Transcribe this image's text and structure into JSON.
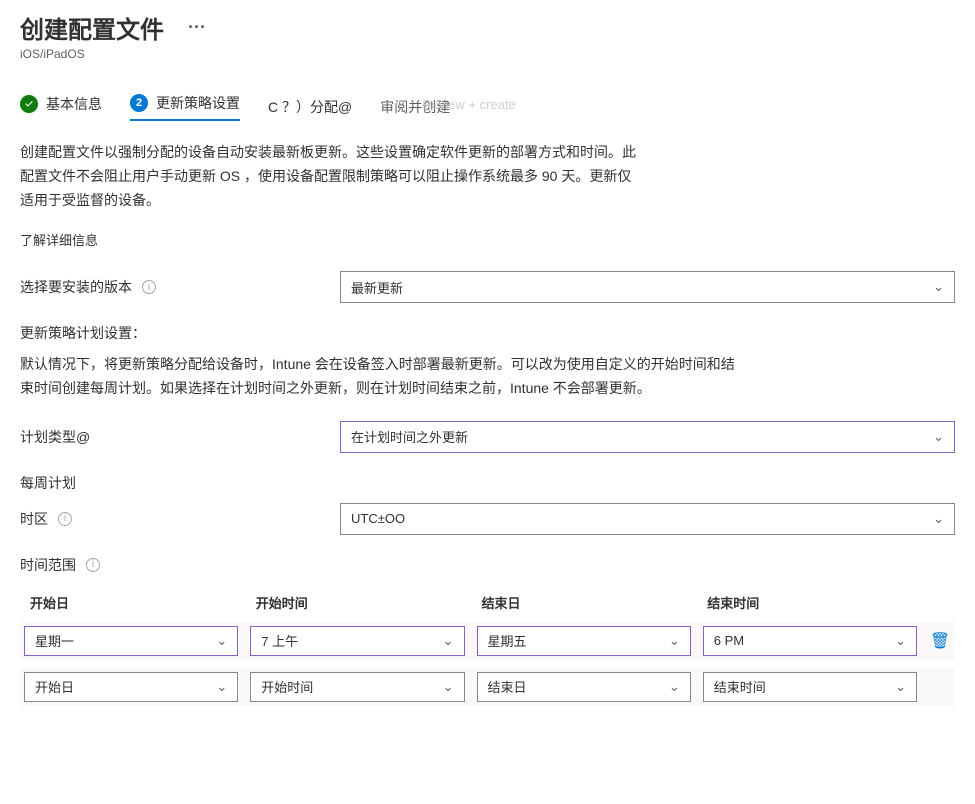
{
  "header": {
    "title": "创建配置文件",
    "subtitle": "iOS/iPadOS",
    "more_menu": "···"
  },
  "steps": {
    "s1": {
      "label": "基本信息"
    },
    "s2": {
      "label": "更新策略设置",
      "num": "2"
    },
    "s3": {
      "label": "C ？）分配@"
    },
    "s4": {
      "label": "审阅并创建",
      "ghost": "Review + create"
    }
  },
  "description": "创建配置文件以强制分配的设备自动安装最新板更新。这些设置确定软件更新的部署方式和时间。此配置文件不会阻止用户手动更新 OS ，使用设备配置限制策略可以阻止操作系统最多 90 天。更新仅适用于受监督的设备。",
  "learn_more": "了解详细信息",
  "version_select": {
    "label": "选择要安装的版本",
    "value": "最新更新"
  },
  "schedule_section": {
    "title": "更新策略计划设置：",
    "desc": "默认情况下，将更新策略分配给设备时，Intune 会在设备签入时部署最新更新。可以改为使用自定义的开始时间和结束时间创建每周计划。如果选择在计划时间之外更新，则在计划时间结束之前，Intune 不会部署更新。"
  },
  "schedule_type": {
    "label": "计划类型@",
    "value": "在计划时间之外更新"
  },
  "weekly": {
    "heading": "每周计划",
    "timezone_label": "时区",
    "timezone_value": "UTC±OO",
    "range_label": "时间范围",
    "columns": {
      "start_day": "开始日",
      "start_time": "开始时间",
      "end_day": "结束日",
      "end_time": "结束时间"
    },
    "rows": [
      {
        "start_day": "星期一",
        "start_time": "7 上午",
        "end_day": "星期五",
        "end_time": "6 PM",
        "deletable": true
      },
      {
        "start_day": "开始日",
        "start_time": "开始时间",
        "end_day": "结束日",
        "end_time": "结束时间",
        "deletable": false
      }
    ]
  }
}
